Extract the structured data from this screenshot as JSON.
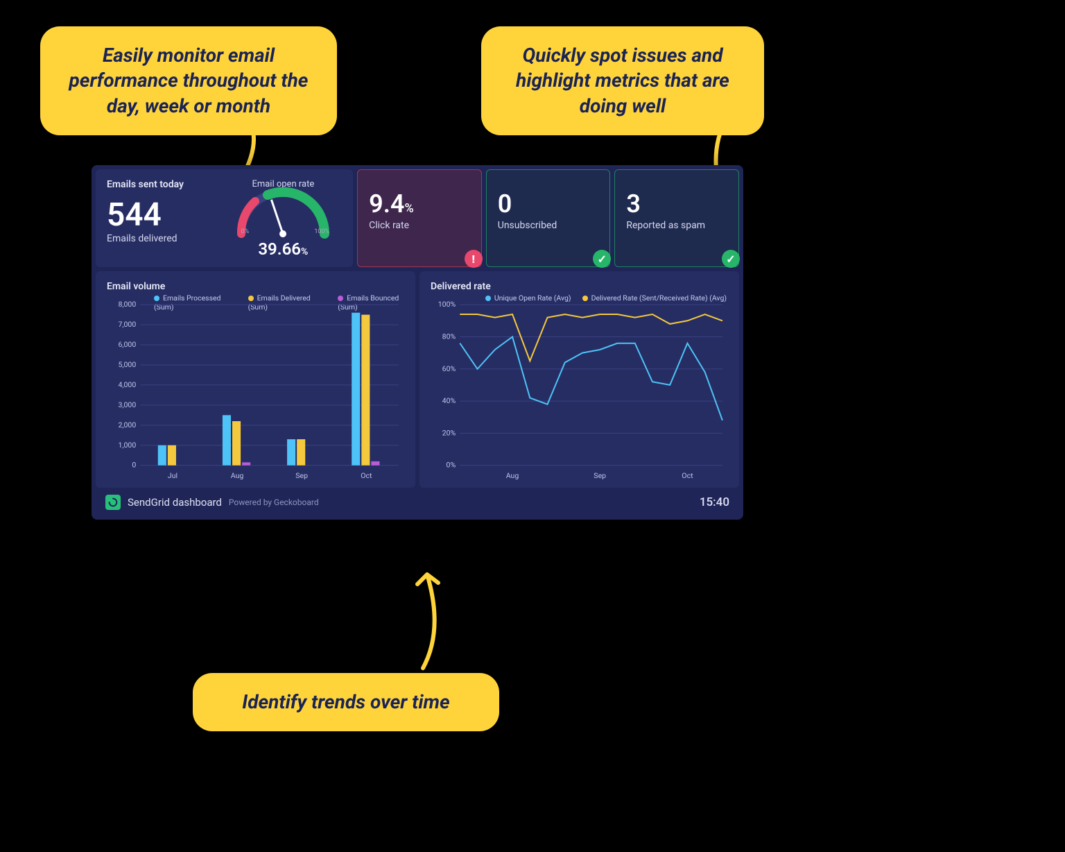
{
  "callouts": {
    "c1": "Easily monitor email performance throughout the day, week or month",
    "c2": "Quickly spot issues and highlight metrics that are doing well",
    "c3": "Identify trends over time"
  },
  "dashboard": {
    "emails_sent": {
      "title": "Emails sent today",
      "value": "544",
      "caption": "Emails delivered"
    },
    "gauge": {
      "title": "Email open rate",
      "value": "39.66",
      "unit": "%",
      "min_label": "0%",
      "max_label": "100%",
      "percent": 39.66
    },
    "metrics": [
      {
        "value": "9.4",
        "unit": "%",
        "caption": "Click rate",
        "status": "warn"
      },
      {
        "value": "0",
        "unit": "",
        "caption": "Unsubscribed",
        "status": "ok"
      },
      {
        "value": "3",
        "unit": "",
        "caption": "Reported as spam",
        "status": "ok"
      }
    ],
    "email_volume": {
      "title": "Email volume"
    },
    "delivered_rate": {
      "title": "Delivered rate"
    },
    "footer": {
      "brand": "SendGrid dashboard",
      "powered": "Powered by Geckoboard",
      "time": "15:40"
    }
  },
  "chart_data": [
    {
      "id": "email_volume",
      "type": "bar",
      "title": "Email volume",
      "categories": [
        "Jul",
        "Aug",
        "Sep",
        "Oct"
      ],
      "series": [
        {
          "name": "Emails Processed (Sum)",
          "color": "#4ec3f7",
          "values": [
            1000,
            2500,
            1300,
            7600
          ]
        },
        {
          "name": "Emails Delivered (Sum)",
          "color": "#f5c93e",
          "values": [
            1000,
            2200,
            1300,
            7500
          ]
        },
        {
          "name": "Emails Bounced (Sum)",
          "color": "#b95cd6",
          "values": [
            0,
            150,
            0,
            200
          ]
        }
      ],
      "ylabel": "",
      "ylim": [
        0,
        8000
      ],
      "yticks": [
        0,
        1000,
        2000,
        3000,
        4000,
        5000,
        6000,
        7000,
        8000
      ],
      "ytick_labels": [
        "0",
        "1,000",
        "2,000",
        "3,000",
        "4,000",
        "5,000",
        "6,000",
        "7,000",
        "8,000"
      ]
    },
    {
      "id": "delivered_rate",
      "type": "line",
      "title": "Delivered rate",
      "x_tick_labels": [
        "Aug",
        "Sep",
        "Oct"
      ],
      "x_tick_positions": [
        3,
        8,
        13
      ],
      "n_points": 16,
      "series": [
        {
          "name": "Unique Open Rate (Avg)",
          "color": "#4ec3f7",
          "values": [
            76,
            60,
            72,
            80,
            42,
            38,
            64,
            70,
            72,
            76,
            76,
            52,
            50,
            76,
            58,
            28
          ]
        },
        {
          "name": "Delivered Rate (Sent/Received Rate) (Avg)",
          "color": "#f5c93e",
          "values": [
            94,
            94,
            92,
            94,
            65,
            92,
            94,
            92,
            94,
            94,
            92,
            94,
            88,
            90,
            94,
            90
          ]
        }
      ],
      "ylabel": "",
      "ylim": [
        0,
        100
      ],
      "yticks": [
        0,
        20,
        40,
        60,
        80,
        100
      ],
      "ytick_labels": [
        "0%",
        "20%",
        "40%",
        "60%",
        "80%",
        "100%"
      ]
    }
  ]
}
